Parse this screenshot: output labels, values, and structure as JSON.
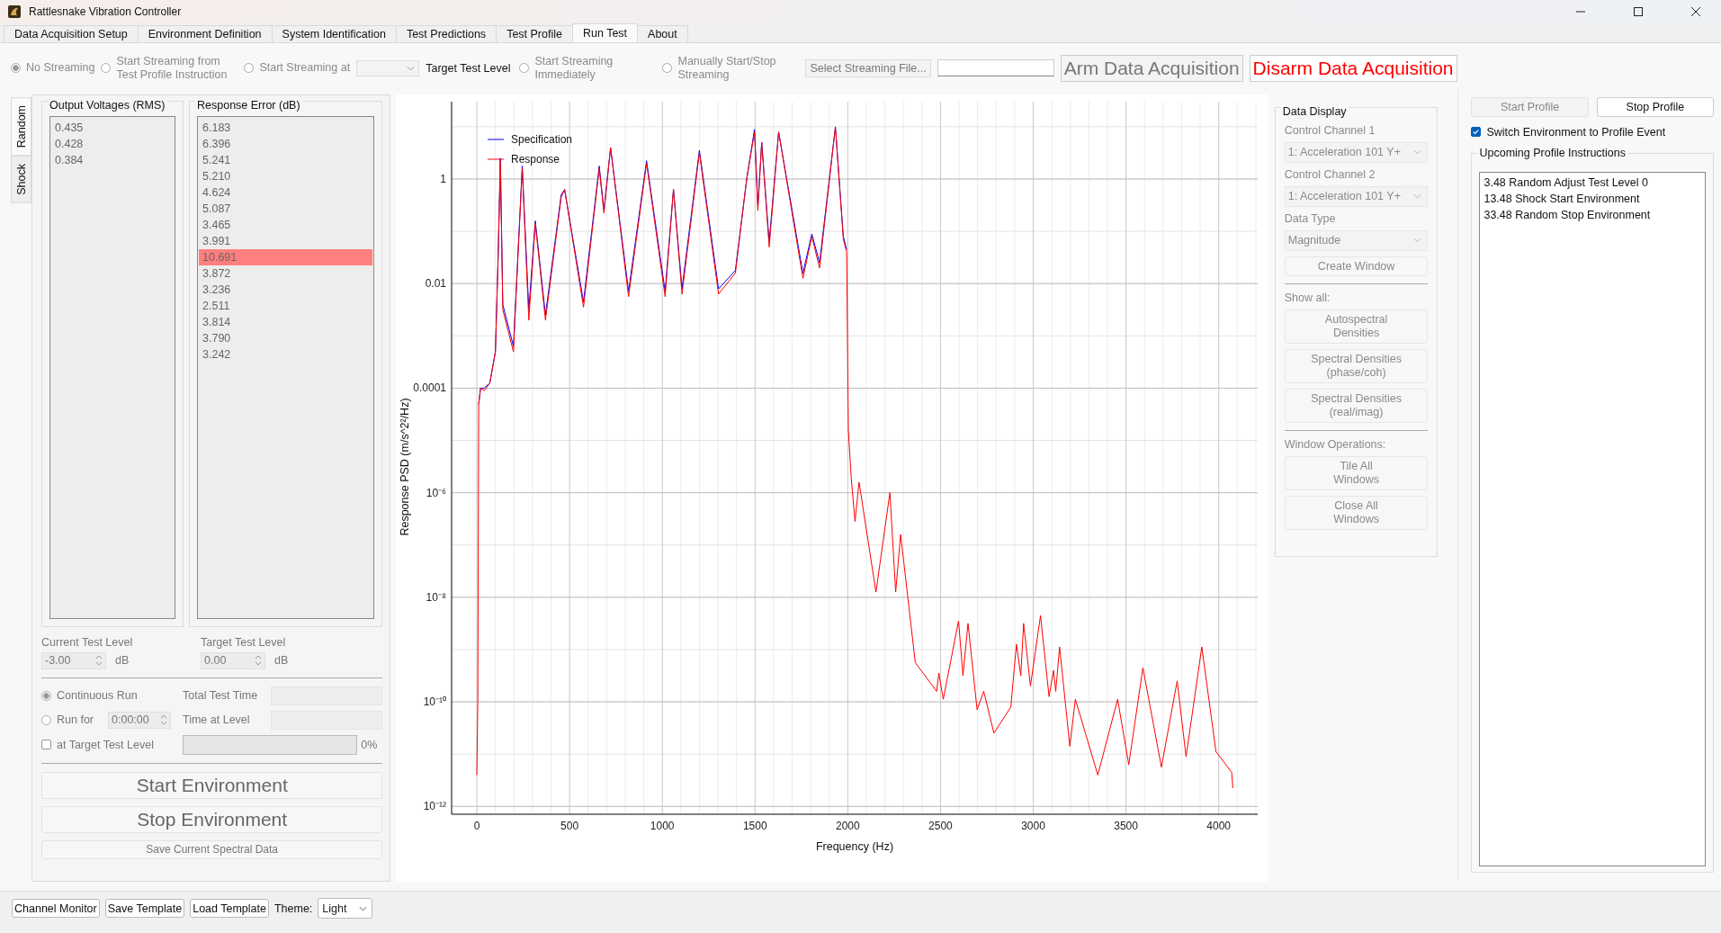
{
  "window": {
    "title": "Rattlesnake Vibration Controller"
  },
  "tabs": [
    {
      "label": "Data Acquisition Setup",
      "selected": false
    },
    {
      "label": "Environment Definition",
      "selected": false
    },
    {
      "label": "System Identification",
      "selected": false
    },
    {
      "label": "Test Predictions",
      "selected": false
    },
    {
      "label": "Test Profile",
      "selected": false
    },
    {
      "label": "Run Test",
      "selected": true
    },
    {
      "label": "About",
      "selected": false
    }
  ],
  "streaming": {
    "disabled": true,
    "items": [
      {
        "kind": "radio",
        "label": "No Streaming",
        "selected": true
      },
      {
        "kind": "radio",
        "label": "Start Streaming from Test Profile Instruction",
        "selected": false
      },
      {
        "kind": "radio",
        "label": "Start Streaming at",
        "selected": false
      },
      {
        "kind": "select"
      },
      {
        "kind": "label",
        "label": "Target Test Level"
      },
      {
        "kind": "radio",
        "label": "Start Streaming Immediately",
        "selected": false
      },
      {
        "kind": "radio",
        "label": "Manually Start/Stop Streaming",
        "selected": false
      }
    ],
    "file_button": "Select Streaming File...",
    "arm_button": {
      "label": "Arm Data Acquisition",
      "disabled": true
    },
    "disarm_button": {
      "label": "Disarm Data Acquisition",
      "disabled": false
    }
  },
  "environment_tabs": [
    {
      "label": "Random",
      "selected": true
    },
    {
      "label": "Shock",
      "selected": false
    }
  ],
  "output_voltages": {
    "title": "Output Voltages (RMS)",
    "items": [
      "0.435",
      "0.428",
      "0.384"
    ]
  },
  "response_error": {
    "title": "Response Error (dB)",
    "items": [
      {
        "value": "6.183",
        "flagged": false
      },
      {
        "value": "6.396",
        "flagged": false
      },
      {
        "value": "5.241",
        "flagged": false
      },
      {
        "value": "5.210",
        "flagged": false
      },
      {
        "value": "4.624",
        "flagged": false
      },
      {
        "value": "5.087",
        "flagged": false
      },
      {
        "value": "3.465",
        "flagged": false
      },
      {
        "value": "3.991",
        "flagged": false
      },
      {
        "value": "10.691",
        "flagged": true
      },
      {
        "value": "3.872",
        "flagged": false
      },
      {
        "value": "3.236",
        "flagged": false
      },
      {
        "value": "2.511",
        "flagged": false
      },
      {
        "value": "3.814",
        "flagged": false
      },
      {
        "value": "3.790",
        "flagged": false
      },
      {
        "value": "3.242",
        "flagged": false
      }
    ]
  },
  "test_levels": [
    {
      "label": "Current Test Level",
      "value": "-3.00",
      "unit": "dB"
    },
    {
      "label": "Target Test Level",
      "value": "0.00",
      "unit": "dB"
    }
  ],
  "run_mode": {
    "continuous": {
      "label": "Continuous Run",
      "selected": true
    },
    "run_for": {
      "label": "Run for",
      "selected": false,
      "value": "0:00:00"
    },
    "total_time_label": "Total Test Time",
    "time_at_level_label": "Time at Level",
    "at_target": {
      "label": "at Target Test Level",
      "checked": false
    },
    "progress": {
      "level": 0,
      "reading": "0%"
    }
  },
  "start_environment": "Start Environment",
  "stop_environment": "Stop Environment",
  "save_spectral": "Save Current Spectral Data",
  "chart": {
    "y_tick_labels": [
      "1",
      "0.01",
      "0.0001",
      "10⁻⁶",
      "10⁻⁸",
      "10⁻¹⁰",
      "10⁻¹²"
    ],
    "x_tick_labels": [
      "0",
      "500",
      "1000",
      "1500",
      "2000",
      "2500",
      "3000",
      "3500",
      "4000"
    ],
    "x_axis_title": "Frequency (Hz)",
    "y_axis_title": "Response PSD (m/s^2²/Hz)",
    "legend": [
      {
        "name": "Specification",
        "color": "#0000ff"
      },
      {
        "name": "Response",
        "color": "#ff0000"
      }
    ]
  },
  "data_display": {
    "title": "Data Display",
    "disabled": true,
    "selects": [
      {
        "label": "Control Channel 1",
        "value": "1: Acceleration 101 Y+"
      },
      {
        "label": "Control Channel 2",
        "value": "1: Acceleration 101 Y+"
      },
      {
        "label": "Data Type",
        "value": "Magnitude"
      }
    ],
    "create_button": "Create Window",
    "show_all_label": "Show all:",
    "show_all_buttons": [
      "Autospectral Densities",
      "Spectral Densities (phase/coh)",
      "Spectral Densities (real/imag)"
    ],
    "window_ops_label": "Window Operations:",
    "window_ops_buttons": [
      "Tile All Windows",
      "Close All Windows"
    ]
  },
  "profile": {
    "start_button": {
      "label": "Start Profile",
      "disabled": true
    },
    "stop_button": {
      "label": "Stop Profile",
      "disabled": false
    },
    "switch_checkbox": {
      "label": "Switch Environment to Profile Event",
      "checked": true
    },
    "instructions_title": "Upcoming Profile Instructions",
    "instructions": [
      "3.48 Random Adjust Test Level 0",
      "13.48 Shock Start Environment",
      "33.48 Random Stop Environment"
    ]
  },
  "bottom_bar": {
    "buttons": [
      "Channel Monitor",
      "Save Template",
      "Load Template"
    ],
    "theme": {
      "label": "Theme:",
      "value": "Light"
    }
  }
}
